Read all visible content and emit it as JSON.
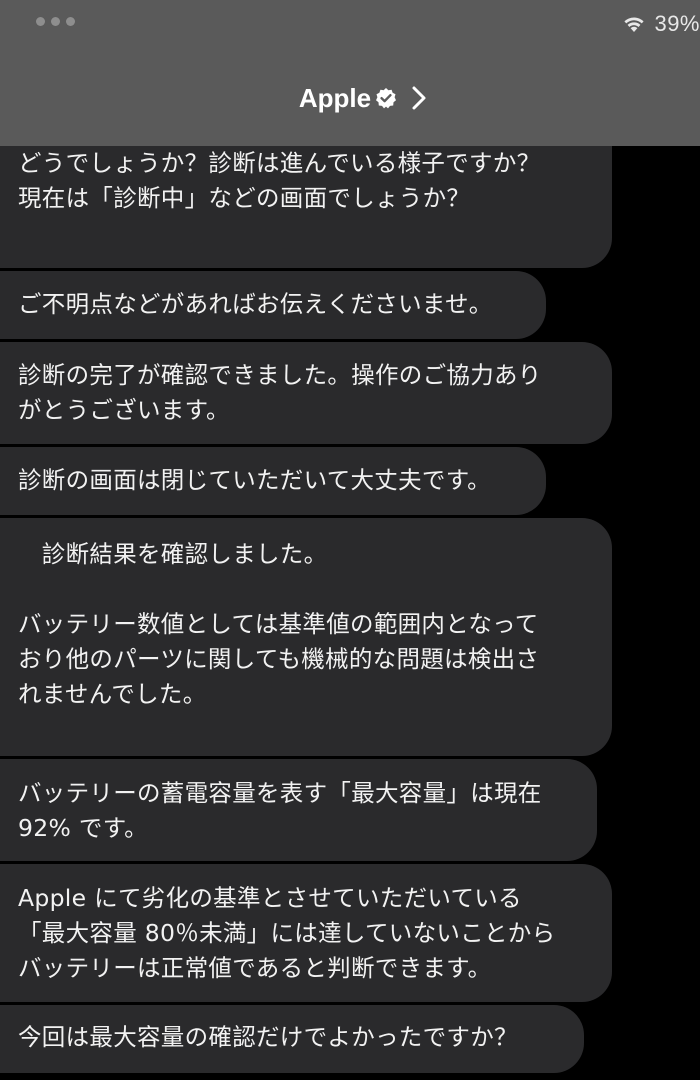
{
  "status_bar": {
    "battery": "39%"
  },
  "header": {
    "title": "Apple"
  },
  "messages": [
    {
      "text": "どうでしょうか？診断は進んでいる様子ですか？\n現在は「診断中」などの画面でしょうか？"
    },
    {
      "text": "ご不明点などがあればお伝えくださいませ。"
    },
    {
      "text": "診断の完了が確認できました。操作のご協力あり\nがとうございます。"
    },
    {
      "text": "診断の画面は閉じていただいて大丈夫です。"
    },
    {
      "text": "　診断結果を確認しました。\n\nバッテリー数値としては基準値の範囲内となって\nおり他のパーツに関しても機械的な問題は検出さ\nれませんでした。"
    },
    {
      "text": "バッテリーの蓄電容量を表す「最大容量」は現在\n92% です。"
    },
    {
      "text": "Apple にて劣化の基準とさせていただいている\n「最大容量 80％未満」には達していないことから\nバッテリーは正常値であると判断できます。"
    },
    {
      "text": "今回は最大容量の確認だけでよかったですか？"
    }
  ],
  "colors": {
    "header_bg": "#5a5a5a",
    "bubble_bg": "#2a2a2c",
    "page_bg": "#000000",
    "text": "#ffffff"
  },
  "icons": {
    "wifi": "wifi-icon",
    "verified": "verified-badge-icon",
    "chevron": "chevron-right-icon"
  }
}
